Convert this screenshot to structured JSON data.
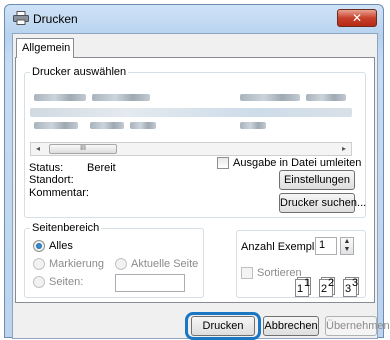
{
  "window": {
    "title": "Drucken",
    "close_glyph": "✕",
    "icon": "printer-icon"
  },
  "tabs": [
    {
      "label": "Allgemein",
      "active": true
    }
  ],
  "printer_group": {
    "legend": "Drucker auswählen",
    "scrollbar": {
      "left_arrow": "◂",
      "right_arrow": "▸",
      "thumb_grip": "III"
    },
    "status_label": "Status:",
    "status_value": "Bereit",
    "location_label": "Standort:",
    "comment_label": "Kommentar:",
    "print_to_file_label": "Ausgabe in Datei umleiten",
    "preferences_button": "Einstellungen",
    "find_printer_button": "Drucker suchen..."
  },
  "page_range": {
    "legend": "Seitenbereich",
    "all_label": "Alles",
    "selection_label": "Markierung",
    "current_page_label": "Aktuelle Seite",
    "pages_label": "Seiten:",
    "pages_value": "",
    "selected": "all"
  },
  "copies": {
    "label": "Anzahl Exemplare:",
    "value": "1",
    "spin_up": "▲",
    "spin_down": "▼",
    "collate_label": "Sortieren",
    "collate_pages": [
      "1",
      "1",
      "2",
      "2",
      "3",
      "3"
    ]
  },
  "footer": {
    "print_button": "Drucken",
    "cancel_button": "Abbrechen",
    "apply_button": "Übernehmen",
    "highlight_color": "#1b76c3"
  }
}
